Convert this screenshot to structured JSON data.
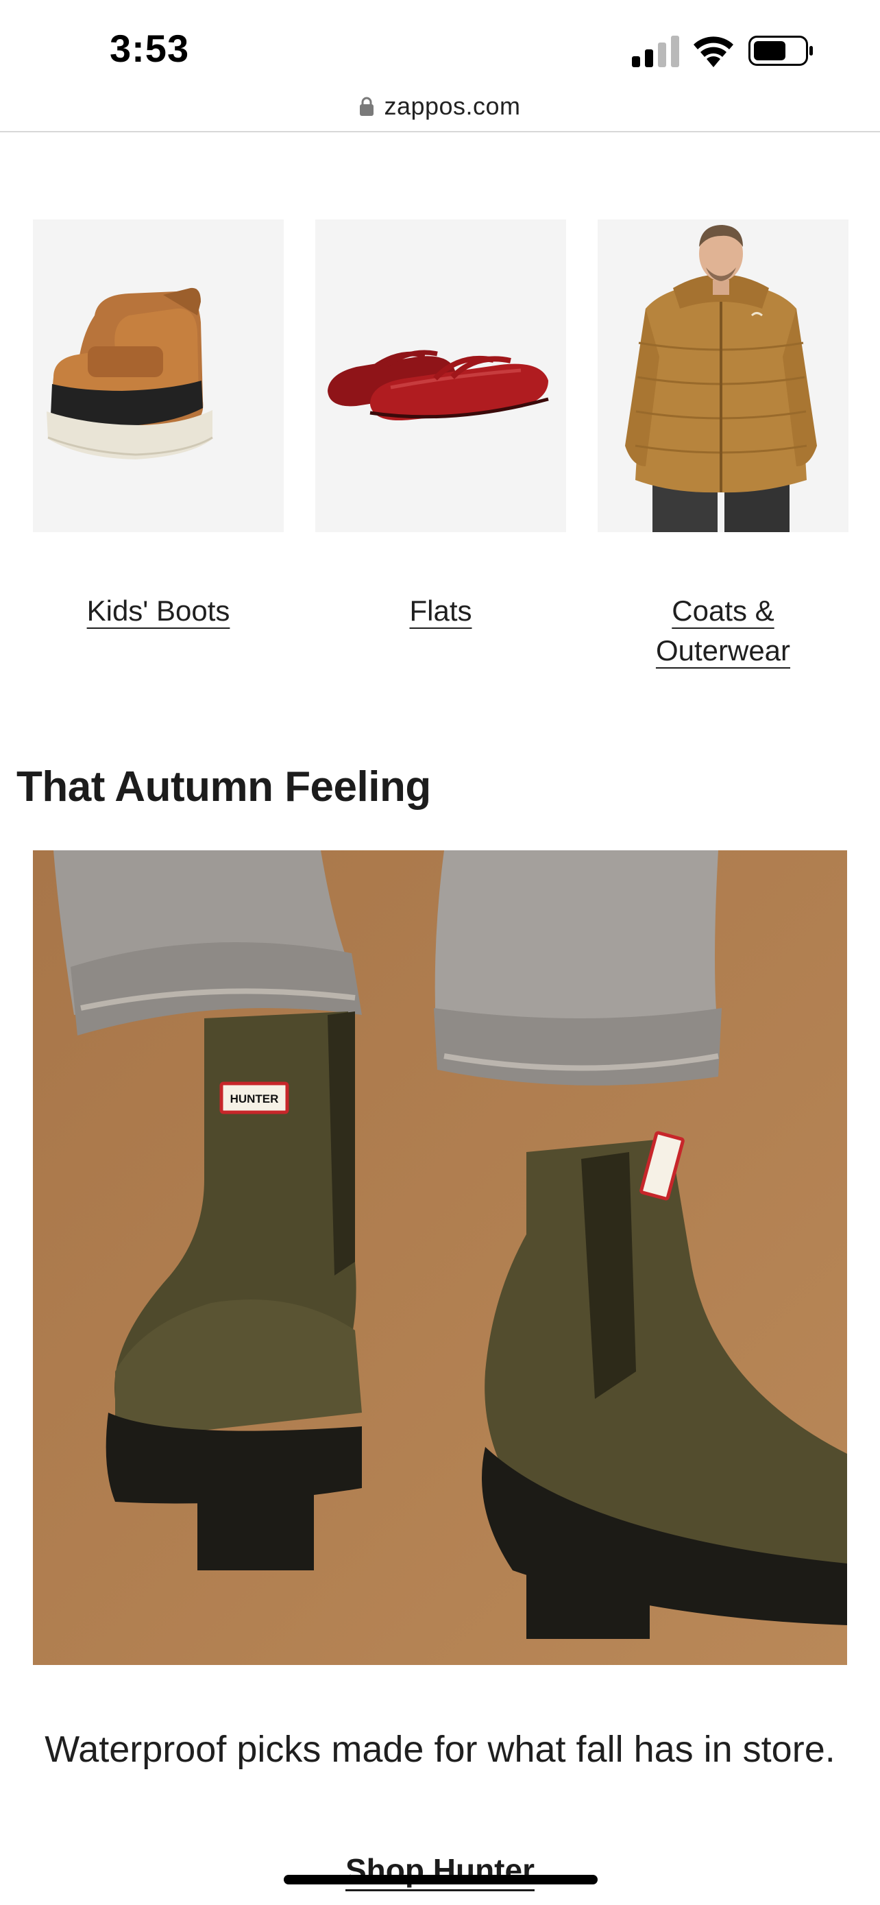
{
  "status_bar": {
    "time": "3:53",
    "icons": [
      "signal-icon",
      "wifi-icon",
      "battery-icon"
    ]
  },
  "browser": {
    "url": "zappos.com",
    "lock_icon": "lock-icon"
  },
  "categories": [
    {
      "label": "Kids' Boots",
      "image": "kids-boots-image"
    },
    {
      "label": "Flats",
      "image": "red-flats-image"
    },
    {
      "label": "Coats &\nOuterwear",
      "image": "coat-model-image"
    }
  ],
  "section": {
    "title": "That Autumn Feeling",
    "hero_image": "olive-hunter-chelsea-boots-image",
    "boot_tag_text": "HUNTER",
    "caption": "Waterproof picks made for what fall has in store.",
    "cta": "Shop Hunter"
  },
  "colors": {
    "tile_bg": "#f4f4f4",
    "hero_bg": "#b07f52",
    "text": "#1f1f1f"
  }
}
